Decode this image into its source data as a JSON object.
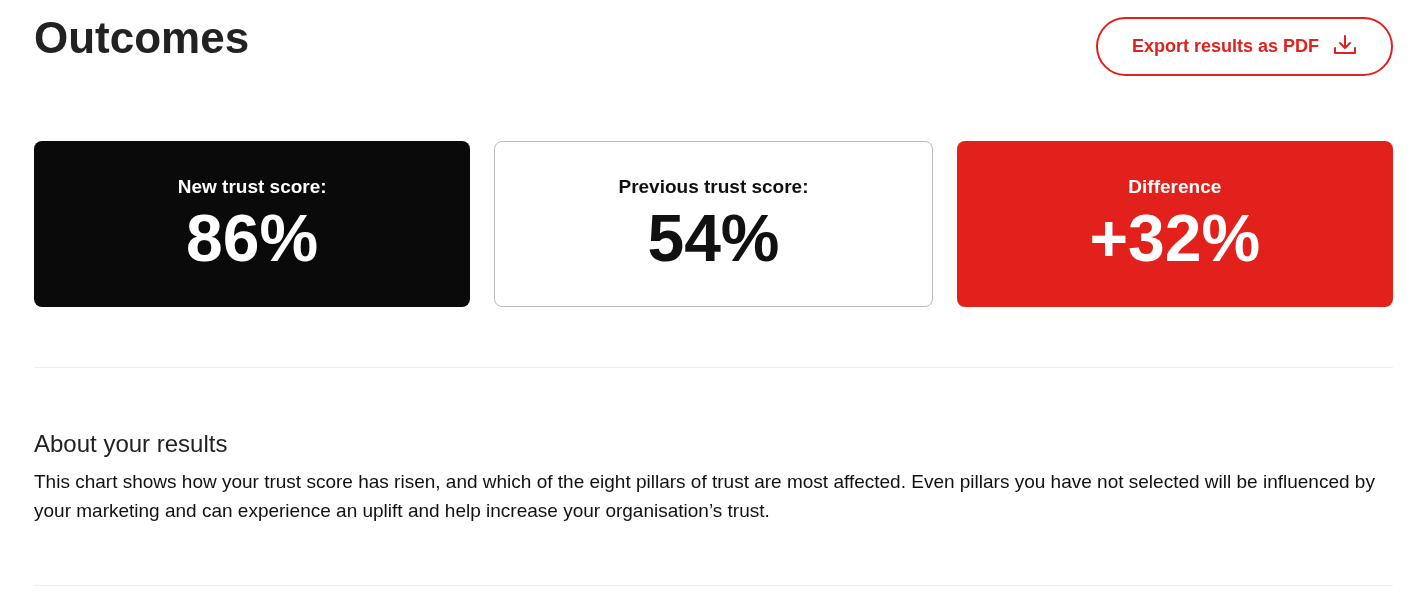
{
  "title": "Outcomes",
  "export_button": {
    "label": "Export results as PDF"
  },
  "score_cards": [
    {
      "kind": "dark",
      "label": "New trust score:",
      "value": "86%"
    },
    {
      "kind": "light",
      "label": "Previous trust score:",
      "value": "54%"
    },
    {
      "kind": "accent",
      "label": "Difference",
      "value": "+32%"
    }
  ],
  "about": {
    "heading": "About your results",
    "text": "This chart shows how your trust score has risen, and which of the eight pillars of trust are most affected. Even pillars you have not selected will be influenced by your marketing and can experience an uplift and help increase your organisation’s trust."
  }
}
